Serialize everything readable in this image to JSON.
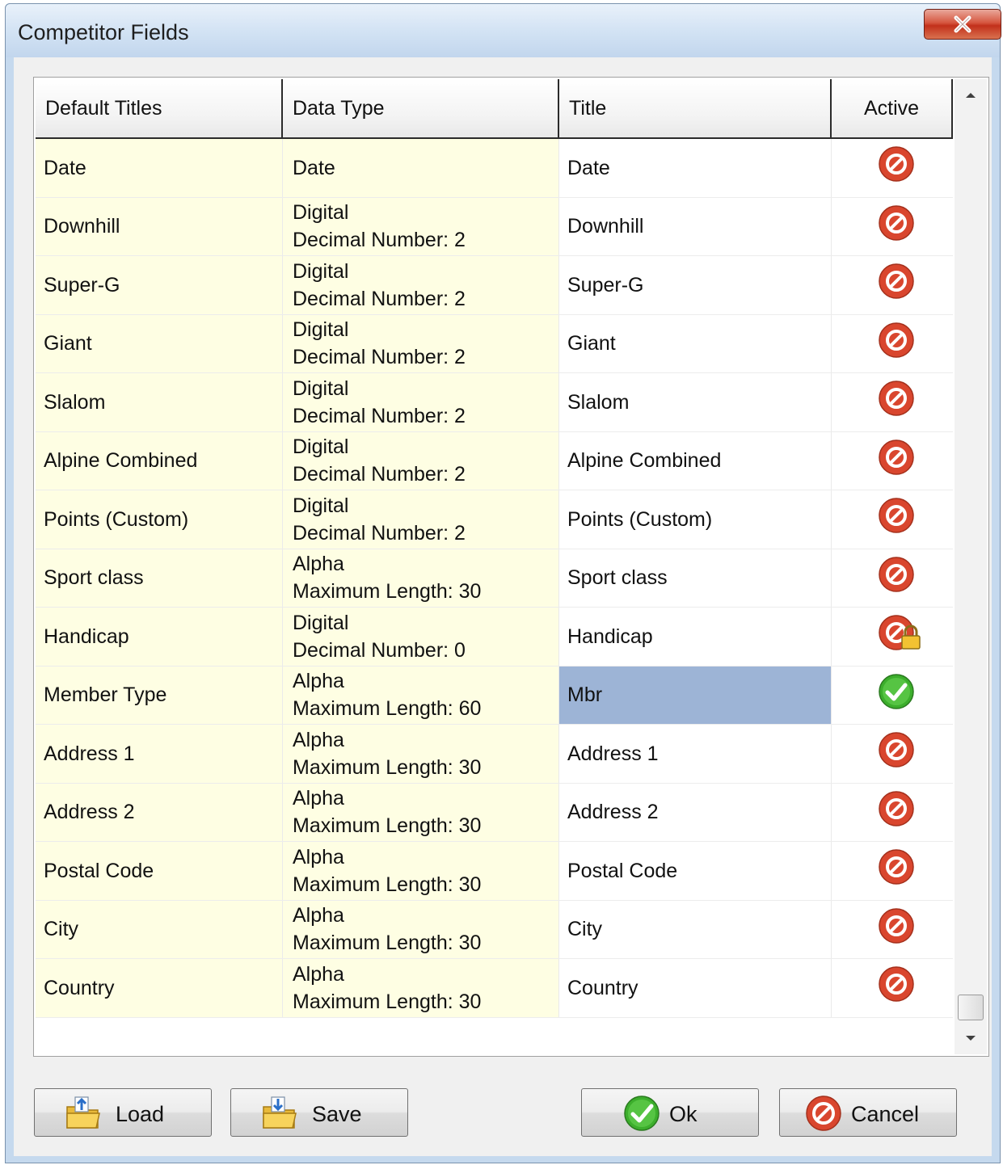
{
  "window": {
    "title": "Competitor Fields",
    "close_icon": "close-icon"
  },
  "grid": {
    "columns": [
      "Default Titles",
      "Data Type",
      "Title",
      "Active"
    ],
    "rows": [
      {
        "default_title": "Date",
        "type_line1": "Date",
        "type_line2": "",
        "title": "Date",
        "active": "inactive"
      },
      {
        "default_title": "Downhill",
        "type_line1": "Digital",
        "type_line2": "Decimal Number: 2",
        "title": "Downhill",
        "active": "inactive"
      },
      {
        "default_title": "Super-G",
        "type_line1": "Digital",
        "type_line2": "Decimal Number: 2",
        "title": "Super-G",
        "active": "inactive"
      },
      {
        "default_title": "Giant",
        "type_line1": "Digital",
        "type_line2": "Decimal Number: 2",
        "title": "Giant",
        "active": "inactive"
      },
      {
        "default_title": "Slalom",
        "type_line1": "Digital",
        "type_line2": "Decimal Number: 2",
        "title": "Slalom",
        "active": "inactive"
      },
      {
        "default_title": "Alpine Combined",
        "type_line1": "Digital",
        "type_line2": "Decimal Number: 2",
        "title": "Alpine Combined",
        "active": "inactive"
      },
      {
        "default_title": "Points (Custom)",
        "type_line1": "Digital",
        "type_line2": "Decimal Number: 2",
        "title": "Points (Custom)",
        "active": "inactive"
      },
      {
        "default_title": "Sport class",
        "type_line1": "Alpha",
        "type_line2": "Maximum Length: 30",
        "title": "Sport class",
        "active": "inactive"
      },
      {
        "default_title": "Handicap",
        "type_line1": "Digital",
        "type_line2": "Decimal Number: 0",
        "title": "Handicap",
        "active": "locked"
      },
      {
        "default_title": "Member Type",
        "type_line1": "Alpha",
        "type_line2": "Maximum Length: 60",
        "title": "Mbr",
        "active": "active",
        "selected": true
      },
      {
        "default_title": "Address 1",
        "type_line1": "Alpha",
        "type_line2": "Maximum Length: 30",
        "title": "Address 1",
        "active": "inactive"
      },
      {
        "default_title": "Address 2",
        "type_line1": "Alpha",
        "type_line2": "Maximum Length: 30",
        "title": "Address 2",
        "active": "inactive"
      },
      {
        "default_title": "Postal Code",
        "type_line1": "Alpha",
        "type_line2": "Maximum Length: 30",
        "title": "Postal Code",
        "active": "inactive"
      },
      {
        "default_title": "City",
        "type_line1": "Alpha",
        "type_line2": "Maximum Length: 30",
        "title": "City",
        "active": "inactive"
      },
      {
        "default_title": "Country",
        "type_line1": "Alpha",
        "type_line2": "Maximum Length: 30",
        "title": "Country",
        "active": "inactive"
      }
    ]
  },
  "buttons": {
    "load": {
      "label": "Load",
      "icon": "folder-load-icon"
    },
    "save": {
      "label": "Save",
      "icon": "folder-save-icon"
    },
    "ok": {
      "label": "Ok",
      "icon": "check-icon"
    },
    "cancel": {
      "label": "Cancel",
      "icon": "cancel-icon"
    }
  },
  "colors": {
    "readonly_cell": "#fefee3",
    "selected_cell": "#9db4d6",
    "inactive_icon": "#d9462e",
    "active_icon": "#3cae2c"
  }
}
